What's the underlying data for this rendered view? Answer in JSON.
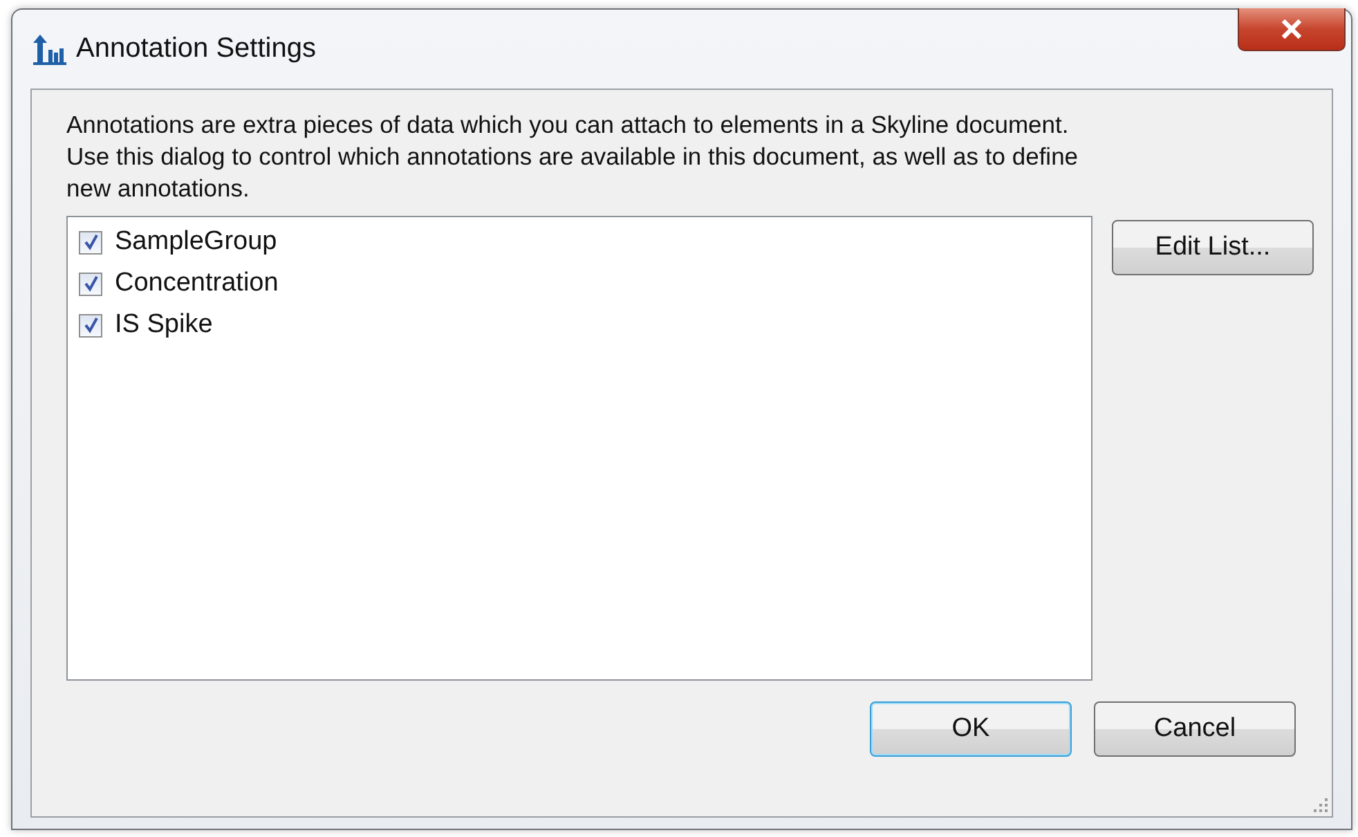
{
  "window": {
    "title": "Annotation Settings"
  },
  "description": [
    "Annotations are extra pieces of data which you can attach to elements in a Skyline document.",
    "Use this dialog to control which annotations are available in this document, as well as to define",
    "new annotations."
  ],
  "annotations": [
    {
      "label": "SampleGroup",
      "checked": true
    },
    {
      "label": "Concentration",
      "checked": true
    },
    {
      "label": "IS Spike",
      "checked": true
    }
  ],
  "edit_button": "Edit List...",
  "buttons": [
    {
      "label": "OK",
      "default": true
    },
    {
      "label": "Cancel",
      "default": false
    }
  ]
}
